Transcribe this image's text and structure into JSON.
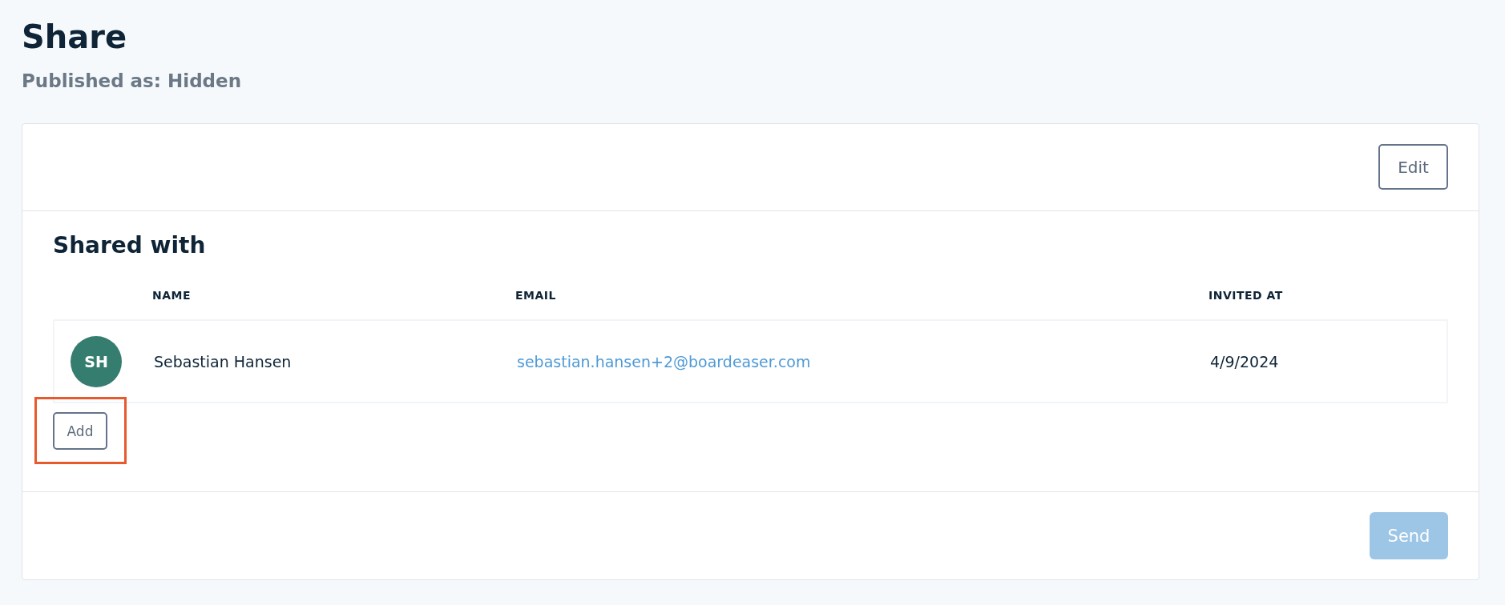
{
  "page": {
    "title": "Share",
    "subtitle": "Published as: Hidden"
  },
  "card": {
    "edit_button": "Edit",
    "section_title": "Shared with",
    "table": {
      "columns": [
        "NAME",
        "EMAIL",
        "INVITED AT"
      ],
      "rows": [
        {
          "initials": "SH",
          "color": "#357d6f",
          "name": "Sebastian Hansen",
          "email": "sebastian.hansen+2@boardeaser.com",
          "invited_at": "4/9/2024"
        }
      ]
    },
    "add_button": {
      "label": "Add",
      "highlighted": true
    },
    "send_button": {
      "label": "Send",
      "disabled": true
    }
  }
}
